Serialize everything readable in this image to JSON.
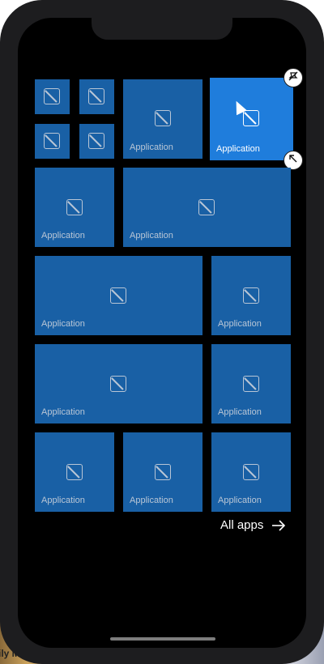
{
  "background_fragment": "ily Mi",
  "tiles": [
    {
      "label": ""
    },
    {
      "label": ""
    },
    {
      "label": ""
    },
    {
      "label": ""
    },
    {
      "label": "Application"
    },
    {
      "label": "Application"
    },
    {
      "label": "Application"
    },
    {
      "label": "Application"
    },
    {
      "label": "Application"
    },
    {
      "label": "Application"
    },
    {
      "label": "Application"
    },
    {
      "label": "Application"
    },
    {
      "label": "Application"
    },
    {
      "label": "Application"
    },
    {
      "label": "Application"
    }
  ],
  "footer": {
    "all_apps_label": "All apps"
  },
  "colors": {
    "tile": "#1960a5",
    "tile_active": "#1f7ddc",
    "background": "#000000"
  },
  "icons": {
    "tile_placeholder": "image-placeholder-icon",
    "unpin": "unpin-icon",
    "resize": "resize-icon",
    "arrow": "arrow-right-icon",
    "cursor": "mouse-cursor-icon"
  }
}
